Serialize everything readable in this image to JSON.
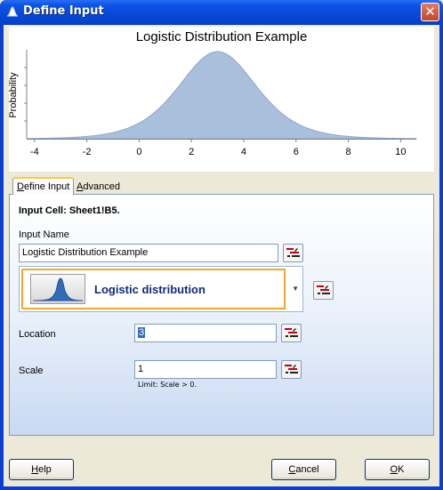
{
  "window": {
    "title": "Define Input",
    "close_glyph": "✕"
  },
  "chart_data": {
    "type": "area",
    "title": "Logistic Distribution Example",
    "ylabel": "Probability",
    "xlabel": "",
    "x_ticks": [
      "-4",
      "-2",
      "0",
      "2",
      "4",
      "6",
      "8",
      "10"
    ],
    "xlim": [
      -4.3,
      10.6
    ],
    "distribution": {
      "name": "logistic",
      "location": 3,
      "scale": 1
    },
    "grid": false,
    "fill_color": "#a9bfdc",
    "stroke_color": "#8ea8cc"
  },
  "tabs": [
    {
      "label": "Define Input",
      "active": true
    },
    {
      "label": "Advanced",
      "active": false
    }
  ],
  "panel": {
    "input_cell": "Input Cell: Sheet1!B5.",
    "input_name_label": "Input Name",
    "input_name_value": "Logistic Distribution Example",
    "distribution_label": "Logistic distribution",
    "location_label": "Location",
    "location_value": "3",
    "scale_label": "Scale",
    "scale_value": "1",
    "scale_limit": "Limit: Scale > 0."
  },
  "buttons": {
    "help": "Help",
    "cancel": "Cancel",
    "ok": "OK"
  }
}
